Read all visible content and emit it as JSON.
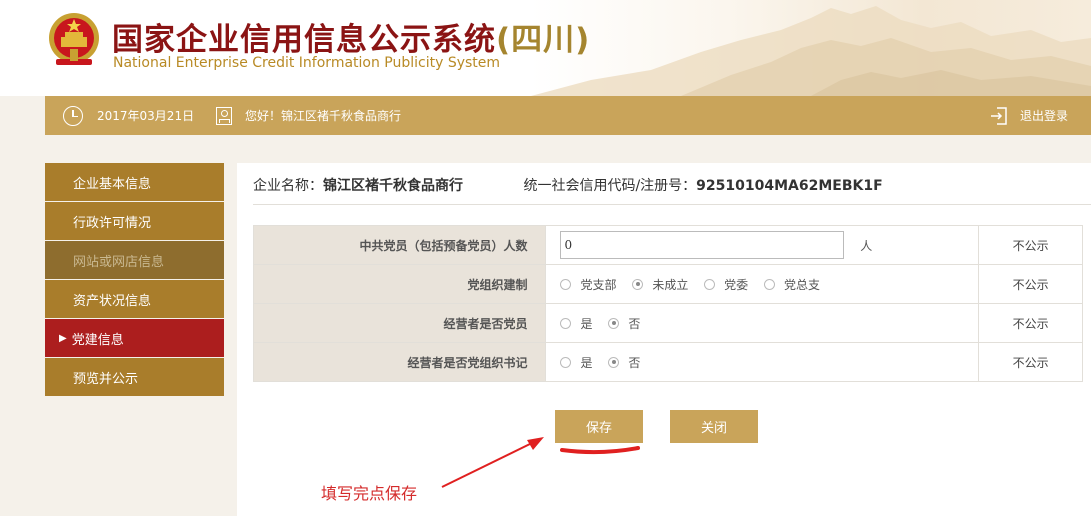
{
  "header": {
    "title_main": "国家企业信用信息公示系统",
    "title_region": "(四川)",
    "title_en": "National Enterprise Credit Information Publicity System"
  },
  "topbar": {
    "date": "2017年03月21日",
    "greeting": "您好！锦江区褚千秋食品商行",
    "logout_label": "退出登录"
  },
  "sidebar": {
    "items": [
      {
        "label": "企业基本信息"
      },
      {
        "label": "行政许可情况"
      },
      {
        "label": "网站或网店信息"
      },
      {
        "label": "资产状况信息"
      },
      {
        "label": "党建信息"
      },
      {
        "label": "预览并公示"
      }
    ]
  },
  "company": {
    "name_label": "企业名称：",
    "name": "锦江区褚千秋食品商行",
    "code_label": "统一社会信用代码/注册号：",
    "code": "92510104MA62MEBK1F"
  },
  "form": {
    "rows": [
      {
        "label": "中共党员（包括预备党员）人数",
        "value": "0",
        "unit": "人",
        "status": "不公示"
      },
      {
        "label": "党组织建制",
        "options": [
          "党支部",
          "未成立",
          "党委",
          "党总支"
        ],
        "selected": 1,
        "status": "不公示"
      },
      {
        "label": "经营者是否党员",
        "options": [
          "是",
          "否"
        ],
        "selected": 1,
        "status": "不公示"
      },
      {
        "label": "经营者是否党组织书记",
        "options": [
          "是",
          "否"
        ],
        "selected": 1,
        "status": "不公示"
      }
    ]
  },
  "buttons": {
    "save_label": "保存",
    "close_label": "关闭"
  },
  "annotation": {
    "text": "填写完点保存",
    "color": "#d42b2b"
  },
  "colors": {
    "gold": "#c9a45a",
    "sidebar": "#a97d2b",
    "active": "#ac1e1e",
    "title_red": "#8b1414"
  }
}
